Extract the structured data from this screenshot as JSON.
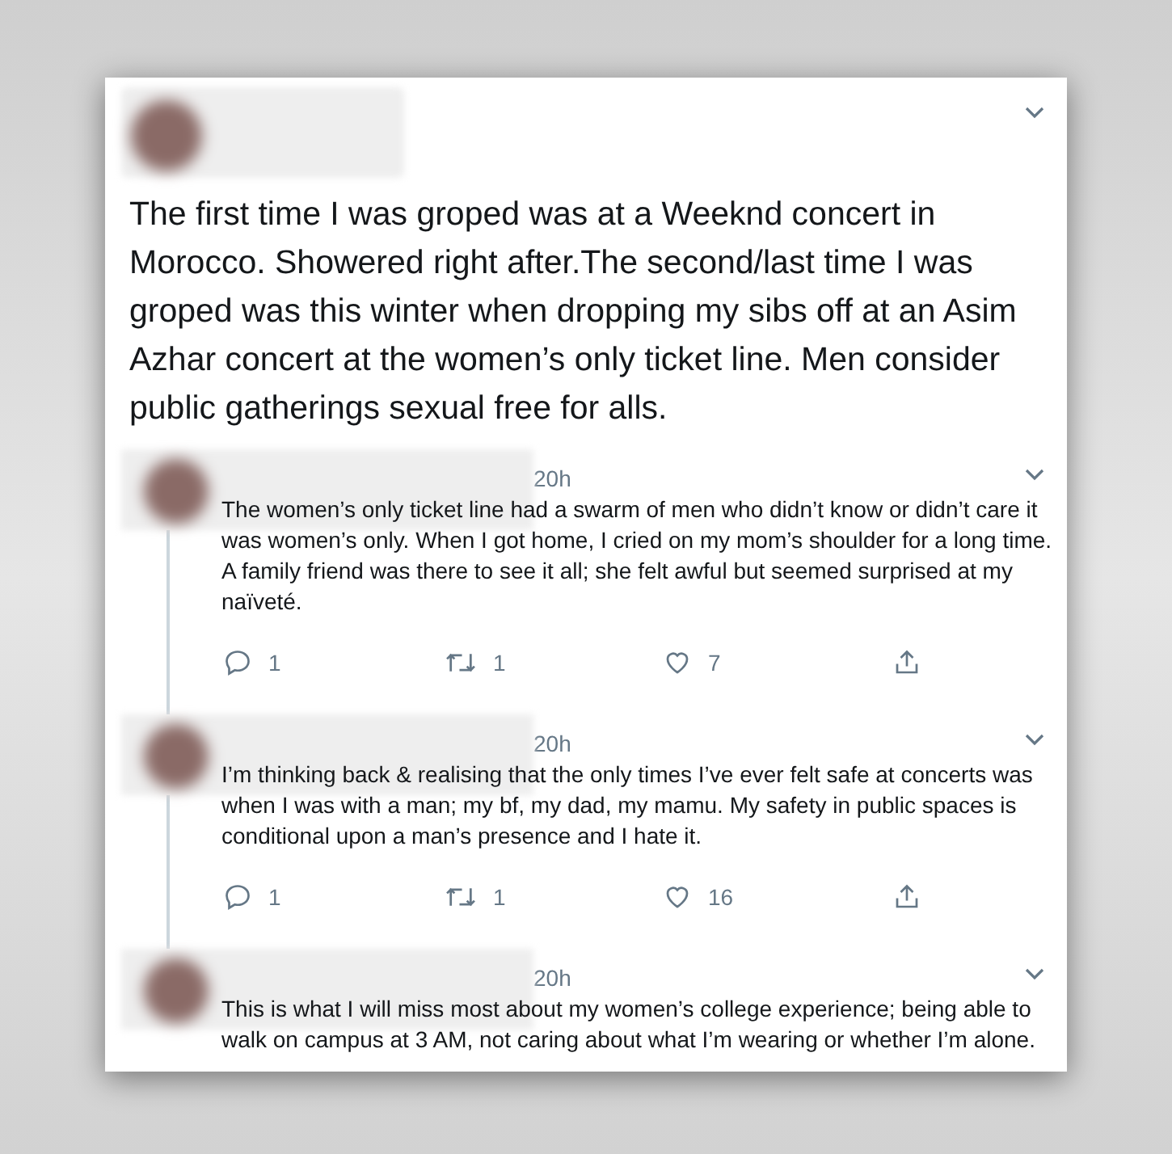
{
  "main_tweet": {
    "text": "The first time I was groped was at a Weeknd concert in Morocco. Showered right after.The second/last time I was groped was this winter when dropping my sibs off at an Asim Azhar concert at the women’s only ticket line. Men consider public gatherings sexual free for alls."
  },
  "replies": [
    {
      "time": "20h",
      "text": "The women’s only ticket line had a swarm of men who didn’t know or didn’t care it was women’s only. When I got home, I cried on my mom’s shoulder for a long time. A family friend was there to see it all; she felt awful but seemed surprised at my naïveté.",
      "replies": "1",
      "retweets": "1",
      "likes": "7"
    },
    {
      "time": "20h",
      "text": "I’m thinking back & realising that the only times I’ve ever felt safe at concerts was when I was with a man; my bf, my dad, my mamu. My safety in public spaces is conditional upon a man’s presence and I hate it.",
      "replies": "1",
      "retweets": "1",
      "likes": "16"
    },
    {
      "time": "20h",
      "text": "This is what I will miss most about my women’s college experience; being able to walk on campus at 3 AM, not caring about what I’m wearing or whether I’m alone."
    }
  ]
}
